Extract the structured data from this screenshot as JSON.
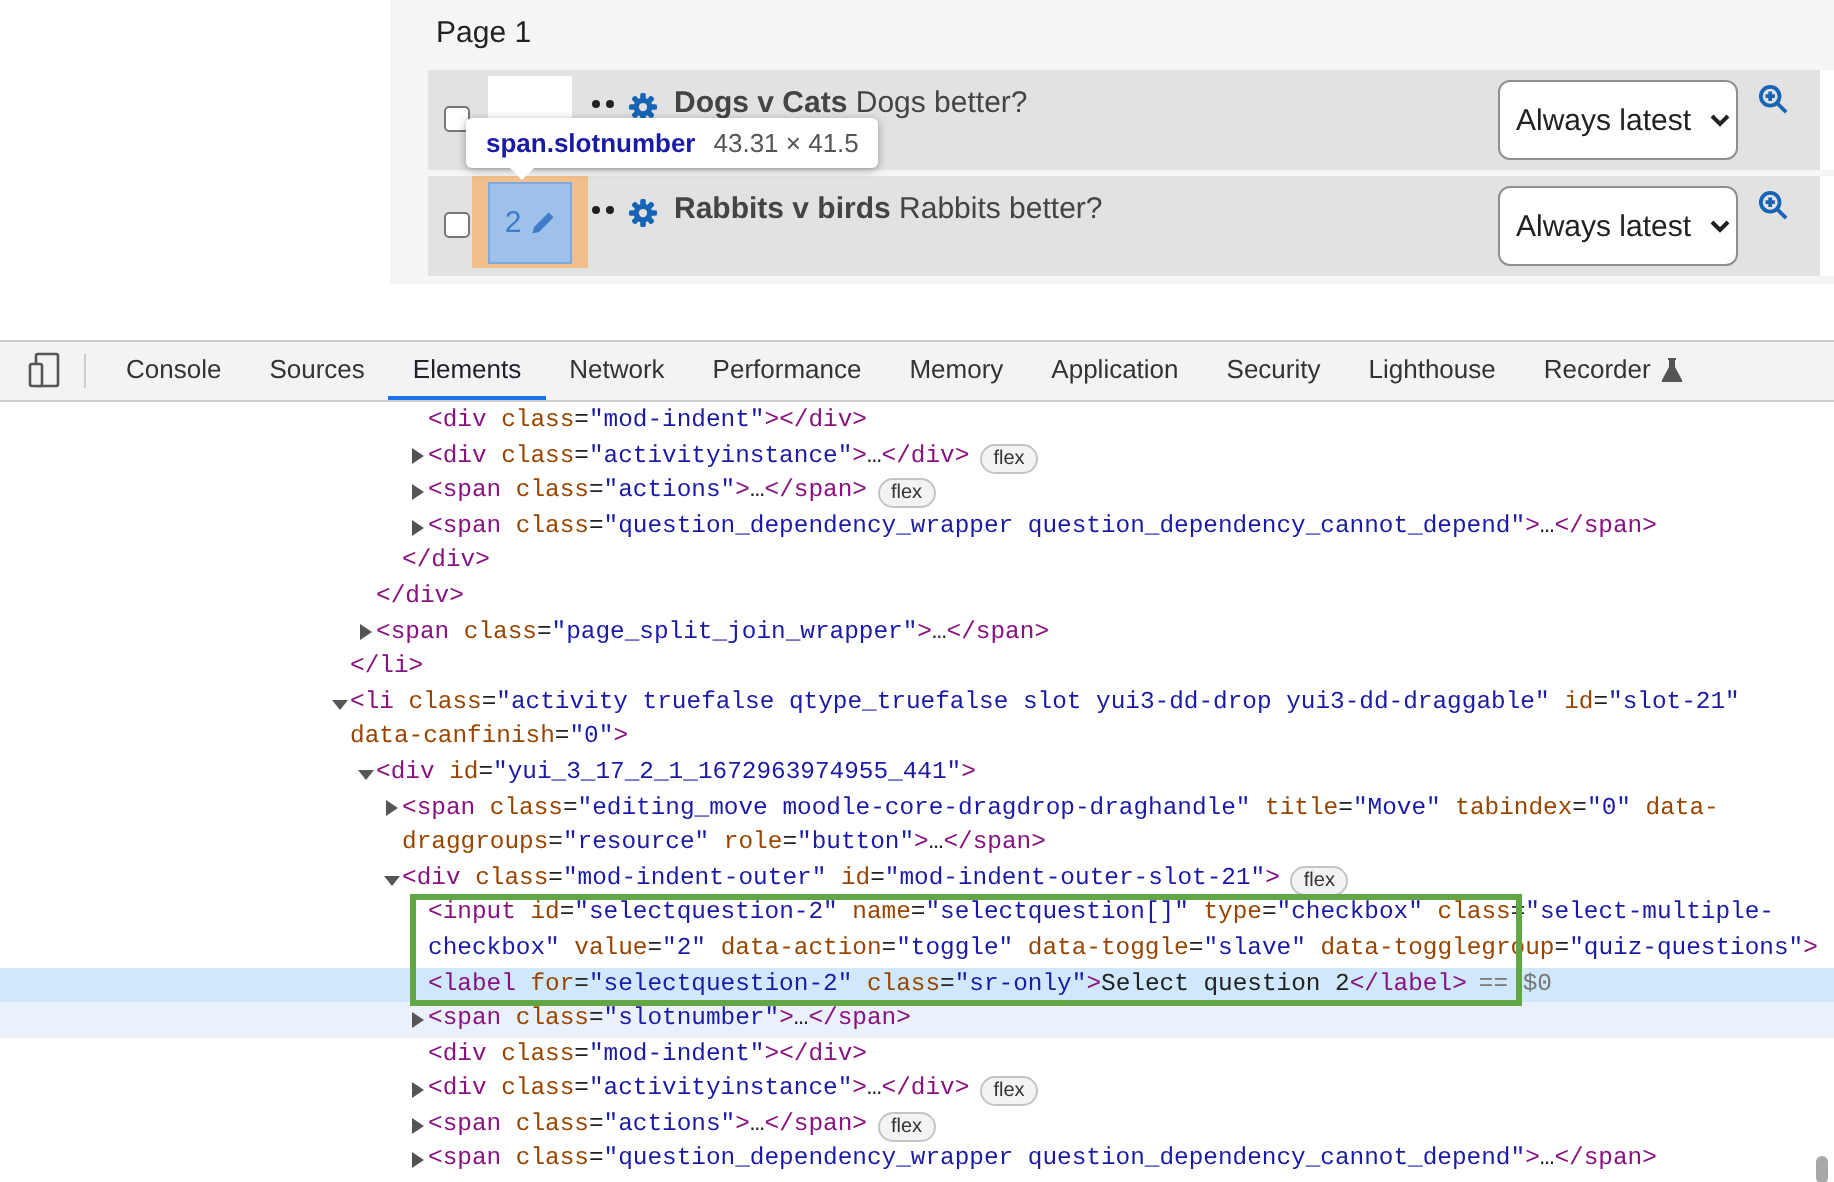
{
  "page_preview": {
    "heading": "Page 1",
    "questions": [
      {
        "title": "Dogs v Cats",
        "text": "Dogs better?",
        "checked": false,
        "inspected": false,
        "version": "Always latest"
      },
      {
        "number": "2",
        "title": "Rabbits v birds",
        "text": "Rabbits better?",
        "checked": false,
        "inspected": true,
        "version": "Always latest"
      }
    ],
    "tooltip": {
      "selector": "span.slotnumber",
      "size": "43.31 × 41.5"
    }
  },
  "devtools_tabs": [
    {
      "label": "Console",
      "selected": false
    },
    {
      "label": "Sources",
      "selected": false
    },
    {
      "label": "Elements",
      "selected": true
    },
    {
      "label": "Network",
      "selected": false
    },
    {
      "label": "Performance",
      "selected": false
    },
    {
      "label": "Memory",
      "selected": false
    },
    {
      "label": "Application",
      "selected": false
    },
    {
      "label": "Security",
      "selected": false
    },
    {
      "label": "Lighthouse",
      "selected": false
    },
    {
      "label": "Recorder",
      "selected": false,
      "experimental": true
    }
  ],
  "dom_tree": [
    {
      "children": [
        {
          "children": [
            {
              "children": [
                {
                  "text": "<div class=\"mod-indent\"></div>",
                  "selected": false,
                  "hovered": false
                },
                {
                  "text": "<div class=\"activityinstance\">…</div>",
                  "expanded": false,
                  "badge": "flex",
                  "selected": false,
                  "hovered": false
                },
                {
                  "text": "<span class=\"actions\">…</span>",
                  "expanded": false,
                  "badge": "flex",
                  "selected": false,
                  "hovered": false
                },
                {
                  "text": "<span class=\"question_dependency_wrapper question_dependency_cannot_depend\">…</span>",
                  "expanded": false,
                  "selected": false,
                  "hovered": false
                }
              ]
            },
            {
              "text": "</div>",
              "selected": false,
              "hovered": false
            }
          ]
        },
        {
          "text": "</div>",
          "selected": false,
          "hovered": false
        },
        {
          "text": "<span class=\"page_split_join_wrapper\">…</span>",
          "expanded": false,
          "selected": false,
          "hovered": false
        }
      ]
    },
    {
      "text": "</li>",
      "selected": false,
      "hovered": false
    },
    {
      "text": "<li class=\"activity truefalse qtype_truefalse slot yui3-dd-drop yui3-dd-draggable\" id=\"slot-21\" data-canfinish=\"0\">",
      "expanded": true,
      "selected": false,
      "hovered": false,
      "children": [
        {
          "text": "<div id=\"yui_3_17_2_1_1672963974955_441\">",
          "expanded": true,
          "selected": false,
          "hovered": false,
          "children": [
            {
              "text": "<span class=\"editing_move moodle-core-dragdrop-draghandle\" title=\"Move\" tabindex=\"0\" data-draggroups=\"resource\" role=\"button\">…</span>",
              "expanded": false,
              "selected": false,
              "hovered": false
            },
            {
              "text": "<div class=\"mod-indent-outer\" id=\"mod-indent-outer-slot-21\">",
              "expanded": true,
              "badge": "flex",
              "selected": false,
              "hovered": false,
              "children": [
                {
                  "text": "<input id=\"selectquestion-2\" name=\"selectquestion[]\" type=\"checkbox\" class=\"select-multiple-checkbox\" value=\"2\" data-action=\"toggle\" data-toggle=\"slave\" data-togglegroup=\"quiz-questions\">",
                  "selected": false,
                  "hovered": false
                },
                {
                  "text": "<label for=\"selectquestion-2\" class=\"sr-only\">Select question 2</label>",
                  "suffix": "== $0",
                  "selected": true,
                  "hovered": false
                },
                {
                  "text": "<span class=\"slotnumber\">…</span>",
                  "expanded": false,
                  "selected": false,
                  "hovered": true
                },
                {
                  "text": "<div class=\"mod-indent\"></div>",
                  "selected": false,
                  "hovered": false
                },
                {
                  "text": "<div class=\"activityinstance\">…</div>",
                  "expanded": false,
                  "badge": "flex",
                  "selected": false,
                  "hovered": false
                },
                {
                  "text": "<span class=\"actions\">…</span>",
                  "expanded": false,
                  "badge": "flex",
                  "selected": false,
                  "hovered": false
                },
                {
                  "text": "<span class=\"question_dependency_wrapper question_dependency_cannot_depend\">…</span>",
                  "expanded": false,
                  "selected": false,
                  "hovered": false
                }
              ]
            }
          ]
        }
      ]
    }
  ]
}
